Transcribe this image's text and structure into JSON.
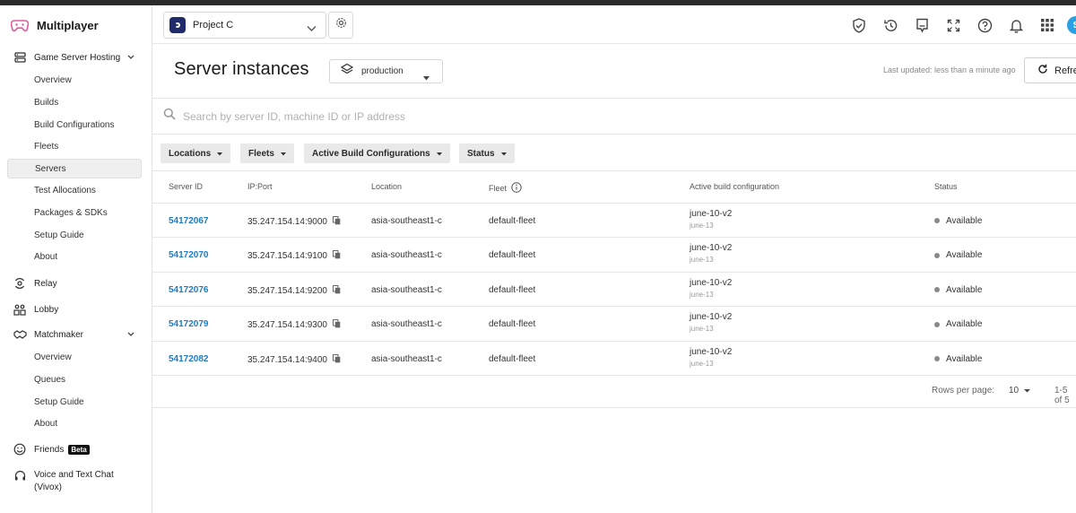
{
  "brand": {
    "title": "Multiplayer"
  },
  "sidebar": {
    "sections": [
      {
        "label": "Game Server Hosting"
      },
      {
        "label": "Relay"
      },
      {
        "label": "Lobby"
      },
      {
        "label": "Matchmaker"
      },
      {
        "label": "Friends",
        "badge": "Beta"
      },
      {
        "label": "Voice and Text Chat",
        "label2": "(Vivox)"
      }
    ],
    "gsh_items": [
      "Overview",
      "Builds",
      "Build Configurations",
      "Fleets",
      "Servers",
      "Test Allocations",
      "Packages & SDKs",
      "Setup Guide",
      "About"
    ],
    "mm_items": [
      "Overview",
      "Queues",
      "Setup Guide",
      "About"
    ],
    "active_item": "Servers"
  },
  "header": {
    "project": "Project C",
    "avatar_initial": "S",
    "icons": [
      "shield-check-icon",
      "history-icon",
      "feedback-icon",
      "fullscreen-icon",
      "help-icon",
      "bell-icon",
      "apps-grid-icon"
    ]
  },
  "page": {
    "title": "Server instances",
    "environment": "production",
    "last_updated": "Last updated: less than a minute ago",
    "refresh_label": "Refresh"
  },
  "search": {
    "placeholder": "Search by server ID, machine ID or IP address"
  },
  "filters": [
    "Locations",
    "Fleets",
    "Active Build Configurations",
    "Status"
  ],
  "table": {
    "columns": [
      "Server ID",
      "IP:Port",
      "Location",
      "Fleet",
      "Active build configuration",
      "Status"
    ],
    "rows": [
      {
        "id": "54172067",
        "ip": "35.247.154.14:9000",
        "location": "asia-southeast1-c",
        "fleet": "default-fleet",
        "build": "june-10-v2",
        "build_sub": "june-13",
        "status": "Available"
      },
      {
        "id": "54172070",
        "ip": "35.247.154.14:9100",
        "location": "asia-southeast1-c",
        "fleet": "default-fleet",
        "build": "june-10-v2",
        "build_sub": "june-13",
        "status": "Available"
      },
      {
        "id": "54172076",
        "ip": "35.247.154.14:9200",
        "location": "asia-southeast1-c",
        "fleet": "default-fleet",
        "build": "june-10-v2",
        "build_sub": "june-13",
        "status": "Available"
      },
      {
        "id": "54172079",
        "ip": "35.247.154.14:9300",
        "location": "asia-southeast1-c",
        "fleet": "default-fleet",
        "build": "june-10-v2",
        "build_sub": "june-13",
        "status": "Available"
      },
      {
        "id": "54172082",
        "ip": "35.247.154.14:9400",
        "location": "asia-southeast1-c",
        "fleet": "default-fleet",
        "build": "june-10-v2",
        "build_sub": "june-13",
        "status": "Available"
      }
    ]
  },
  "pagination": {
    "rows_per_page_label": "Rows per page:",
    "rows_per_page": "10",
    "range": "1-5 of 5"
  },
  "colors": {
    "link": "#1f7bc1",
    "brand_icon": "#e05a9c",
    "avatar": "#2b9fe3",
    "project_icon": "#1f2b6b"
  }
}
